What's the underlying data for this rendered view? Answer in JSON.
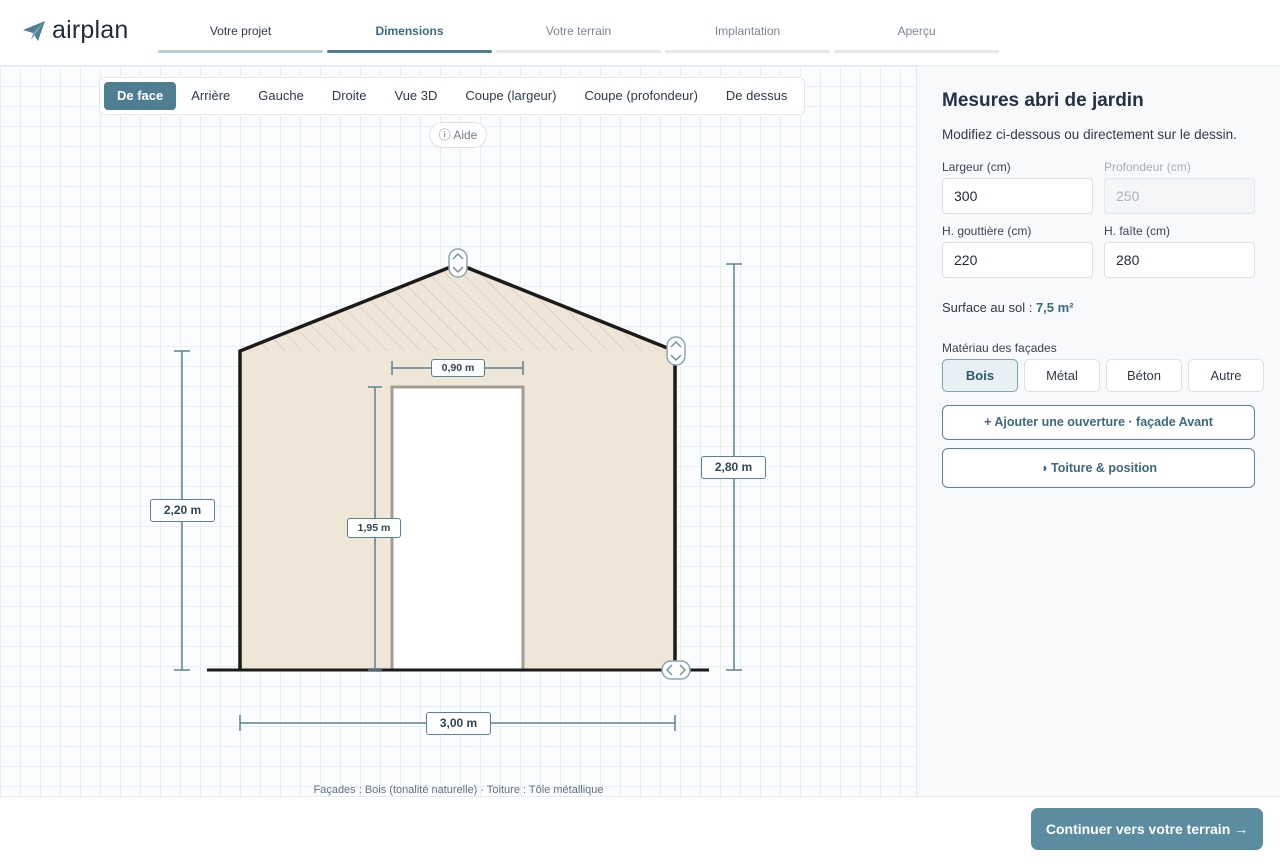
{
  "brand": {
    "name": "airplan",
    "accent": "#4f7d91"
  },
  "steps": [
    {
      "label": "Votre projet",
      "state": "done"
    },
    {
      "label": "Dimensions",
      "state": "active"
    },
    {
      "label": "Votre terrain",
      "state": "todo"
    },
    {
      "label": "Implantation",
      "state": "todo"
    },
    {
      "label": "Aperçu",
      "state": "todo"
    }
  ],
  "view_tabs": [
    "De face",
    "Arrière",
    "Gauche",
    "Droite",
    "Vue 3D",
    "Coupe (largeur)",
    "Coupe (profondeur)",
    "De dessus"
  ],
  "active_view": "De face",
  "help_label": "ⓘ Aide",
  "drawing": {
    "width_label": "3,00 m",
    "eave_height_label": "2,20 m",
    "ridge_height_label": "2,80 m",
    "door_width_label": "0,90 m",
    "door_height_label": "1,95 m",
    "caption": "Façades : Bois (tonalité naturelle) · Toiture : Tôle métallique"
  },
  "panel": {
    "title": "Mesures abri de jardin",
    "subtitle": "Modifiez ci-dessous ou directement sur le dessin.",
    "fields": {
      "width": {
        "label": "Largeur (cm)",
        "value": "300"
      },
      "depth": {
        "label": "Profondeur (cm)",
        "value": "250"
      },
      "eave": {
        "label": "H. gouttière (cm)",
        "value": "220"
      },
      "ridge": {
        "label": "H. faîte (cm)",
        "value": "280"
      }
    },
    "surface_label": "Surface au sol :",
    "surface_value": "7,5 m²",
    "material_label": "Matériau des façades",
    "materials": [
      "Bois",
      "Métal",
      "Béton",
      "Autre"
    ],
    "active_material": "Bois",
    "add_opening": "+ Ajouter une ouverture · façade Avant",
    "roof_button": "◑ Toiture & position"
  },
  "footer": {
    "continue": "Continuer vers votre terrain →"
  }
}
